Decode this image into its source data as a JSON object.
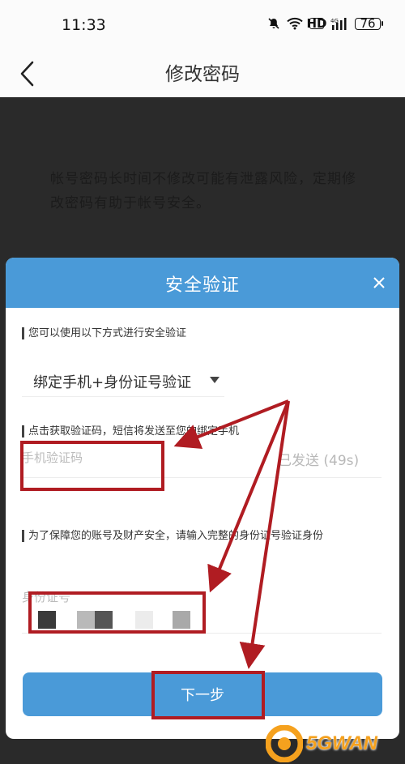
{
  "status_bar": {
    "time": "11:33",
    "battery": "76",
    "hd": "HD",
    "signal": "4G"
  },
  "nav": {
    "title": "修改密码"
  },
  "page": {
    "notice": "帐号密码长时间不修改可能有泄露风险，定期修改密码有助于帐号安全。"
  },
  "dialog": {
    "title": "安全验证",
    "method_hint": "您可以使用以下方式进行安全验证",
    "method_selected": "绑定手机+身份证号验证",
    "sms_hint": "点击获取验证码，短信将发送至您的绑定手机",
    "sms_placeholder": "手机验证码",
    "resend_label": "已发送 (49s)",
    "id_hint": "为了保障您的账号及财产安全，请输入完整的身份证号验证身份",
    "id_placeholder": "身份证号",
    "next_label": "下一步"
  },
  "watermark": {
    "text": "5GWAN"
  },
  "colors": {
    "accent": "#4a9ad8",
    "annotation": "#b01c22",
    "overlay": "#2a2a2a"
  }
}
